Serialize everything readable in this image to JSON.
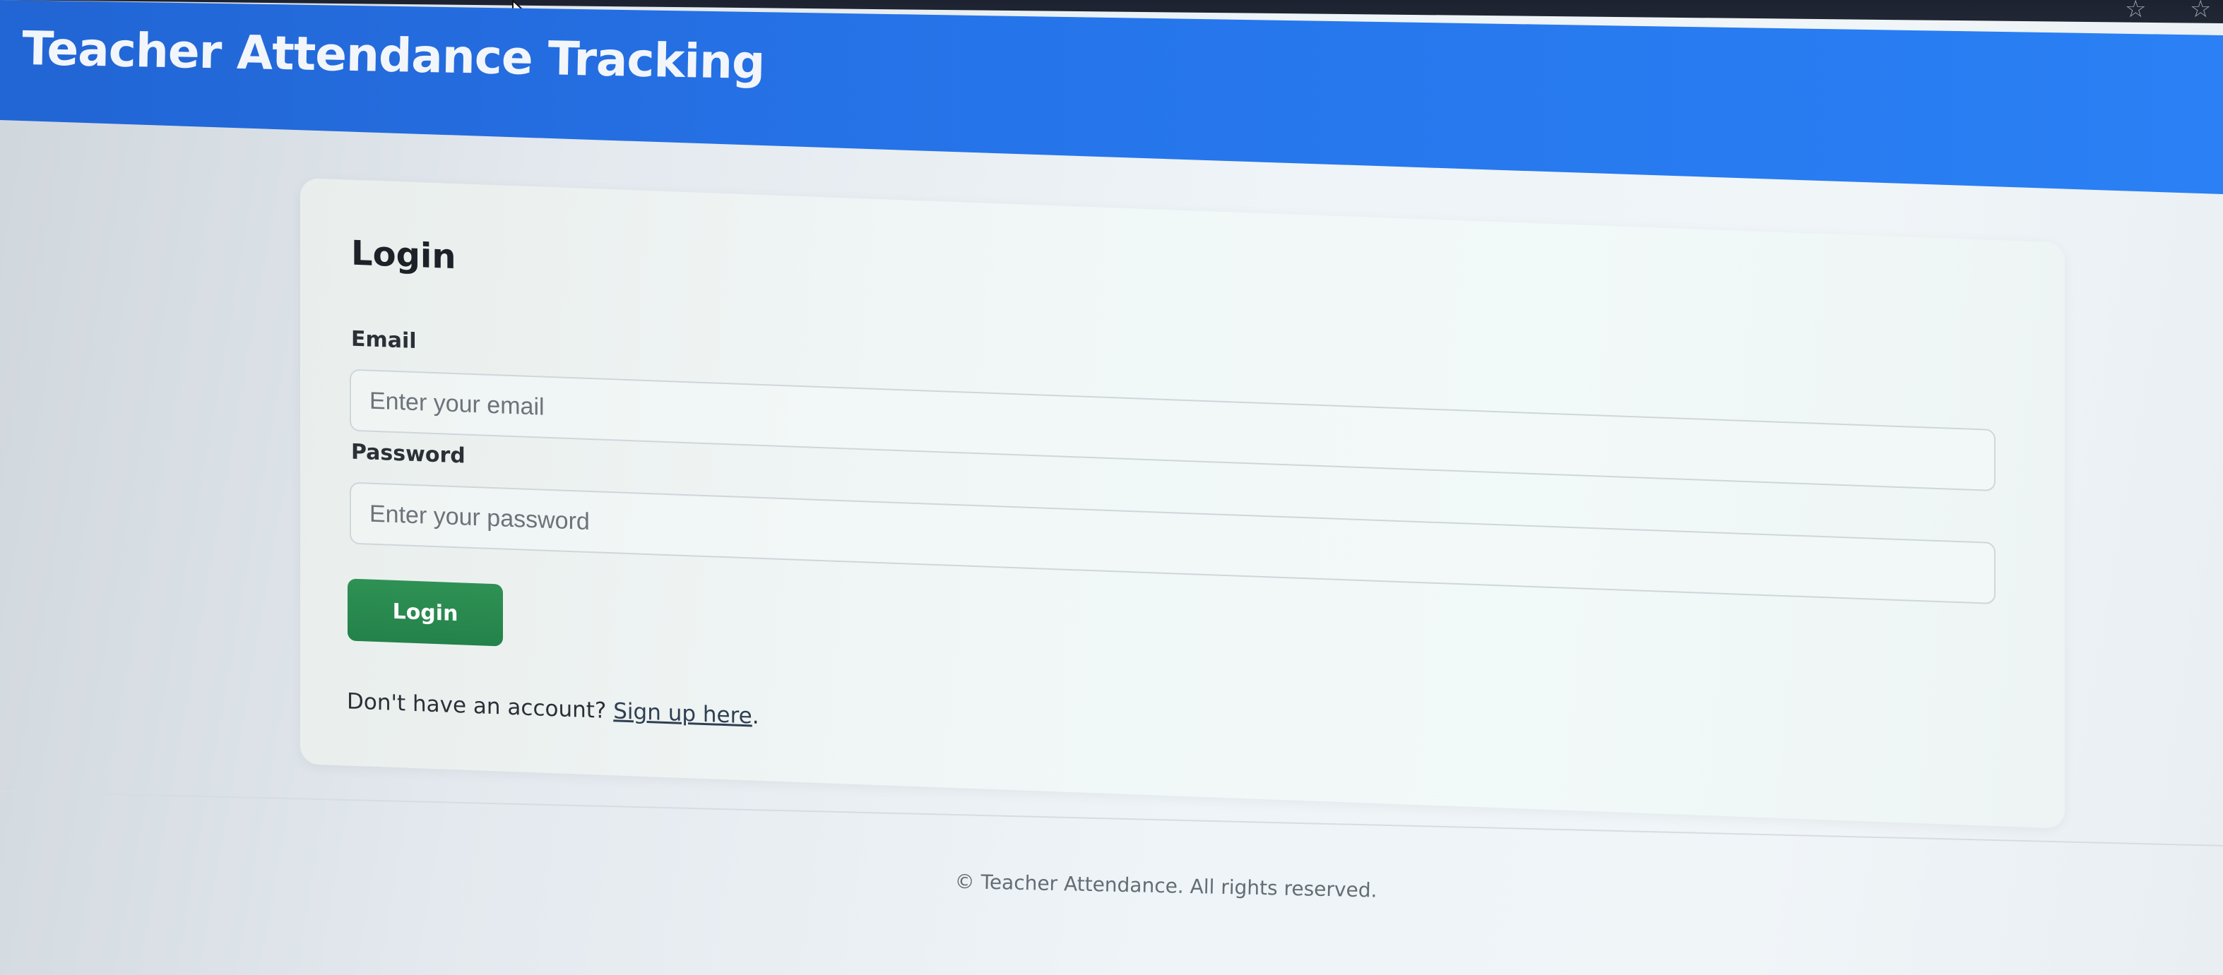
{
  "browser": {
    "bookmark_icon": "star-outline",
    "reading_list_icon": "star-list"
  },
  "header": {
    "title": "Teacher Attendance Tracking",
    "background_color": "#2674ea"
  },
  "login_form": {
    "title": "Login",
    "email": {
      "label": "Email",
      "placeholder": "Enter your email",
      "value": ""
    },
    "password": {
      "label": "Password",
      "placeholder": "Enter your password",
      "value": ""
    },
    "submit_label": "Login",
    "submit_color": "#2a8a4f",
    "signup_prompt": "Don't have an account?",
    "signup_link_text": "Sign up here",
    "signup_suffix": "."
  },
  "footer": {
    "text": "© Teacher Attendance. All rights reserved."
  }
}
